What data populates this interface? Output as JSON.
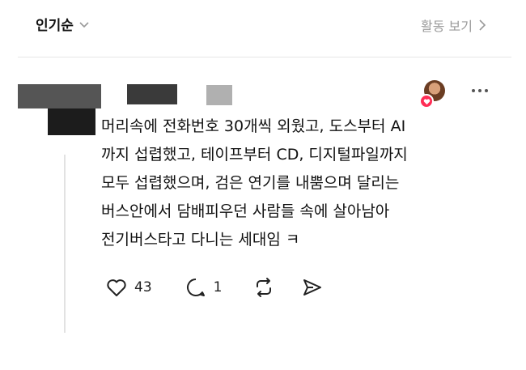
{
  "header": {
    "sort_label": "인기순",
    "activity_label": "활동 보기"
  },
  "post": {
    "body": "머리속에 전화번호 30개씩 외웠고, 도스부터 AI\n까지 섭렵했고, 테이프부터 CD, 디지털파일까지\n모두 섭렵했으며, 검은 연기를 내뿜으며 달리는\n버스안에서 담배피우던 사람들 속에 살아남아\n전기버스타고 다니는 세대임 ㅋ"
  },
  "actions": {
    "likes": "43",
    "comments": "1"
  },
  "icons": [
    "chevron-down-icon",
    "chevron-right-icon",
    "heart-icon",
    "more-icon",
    "like-icon",
    "comment-icon",
    "repost-icon",
    "share-icon"
  ],
  "colors": {
    "heart": "#ff2d55",
    "muted": "#9a9a9a"
  }
}
